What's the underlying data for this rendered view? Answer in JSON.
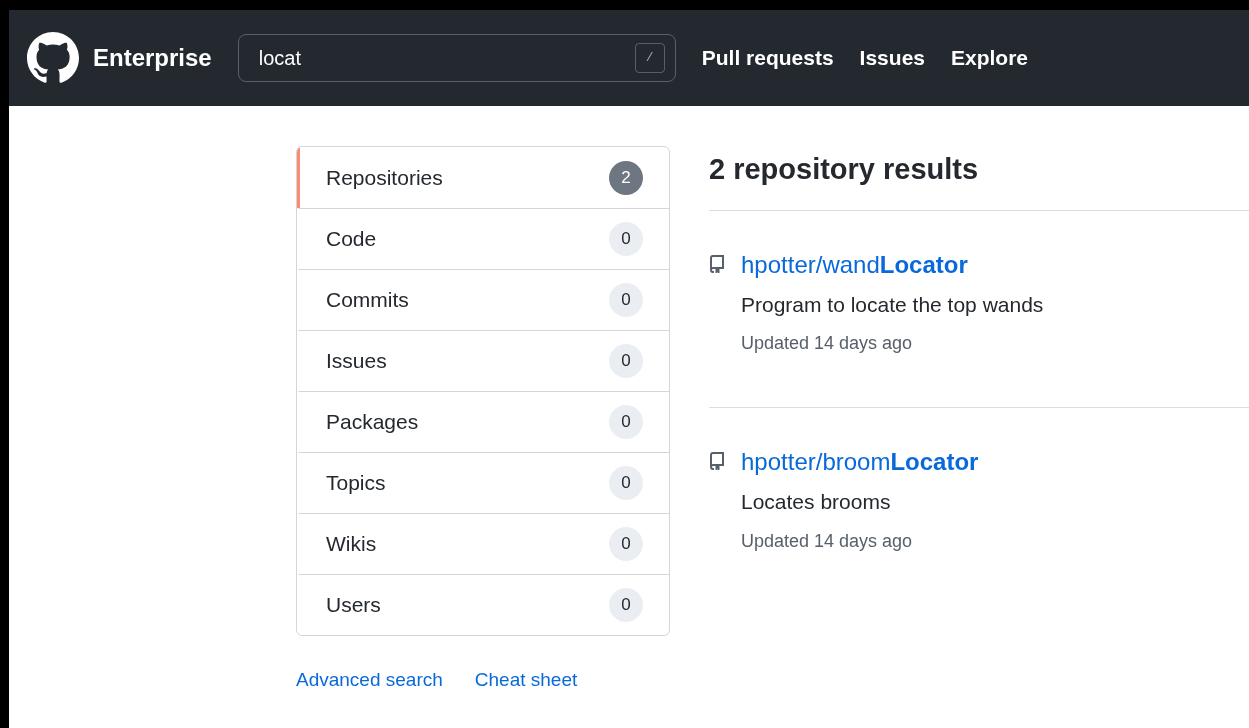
{
  "header": {
    "brand": "Enterprise",
    "search": {
      "value": "locat",
      "shortcut": "/"
    },
    "nav": [
      "Pull requests",
      "Issues",
      "Explore"
    ]
  },
  "sidebar": {
    "items": [
      {
        "label": "Repositories",
        "count": "2",
        "selected": true
      },
      {
        "label": "Code",
        "count": "0",
        "selected": false
      },
      {
        "label": "Commits",
        "count": "0",
        "selected": false
      },
      {
        "label": "Issues",
        "count": "0",
        "selected": false
      },
      {
        "label": "Packages",
        "count": "0",
        "selected": false
      },
      {
        "label": "Topics",
        "count": "0",
        "selected": false
      },
      {
        "label": "Wikis",
        "count": "0",
        "selected": false
      },
      {
        "label": "Users",
        "count": "0",
        "selected": false
      }
    ],
    "links": [
      "Advanced search",
      "Cheat sheet"
    ]
  },
  "results": {
    "heading": "2 repository results",
    "items": [
      {
        "name": "hpotter/wand**Locator**",
        "description": "Program to locate the top wands",
        "updated": "Updated 14 days ago"
      },
      {
        "name": "hpotter/broom**Locator**",
        "description": "Locates brooms",
        "updated": "Updated 14 days ago"
      }
    ]
  }
}
